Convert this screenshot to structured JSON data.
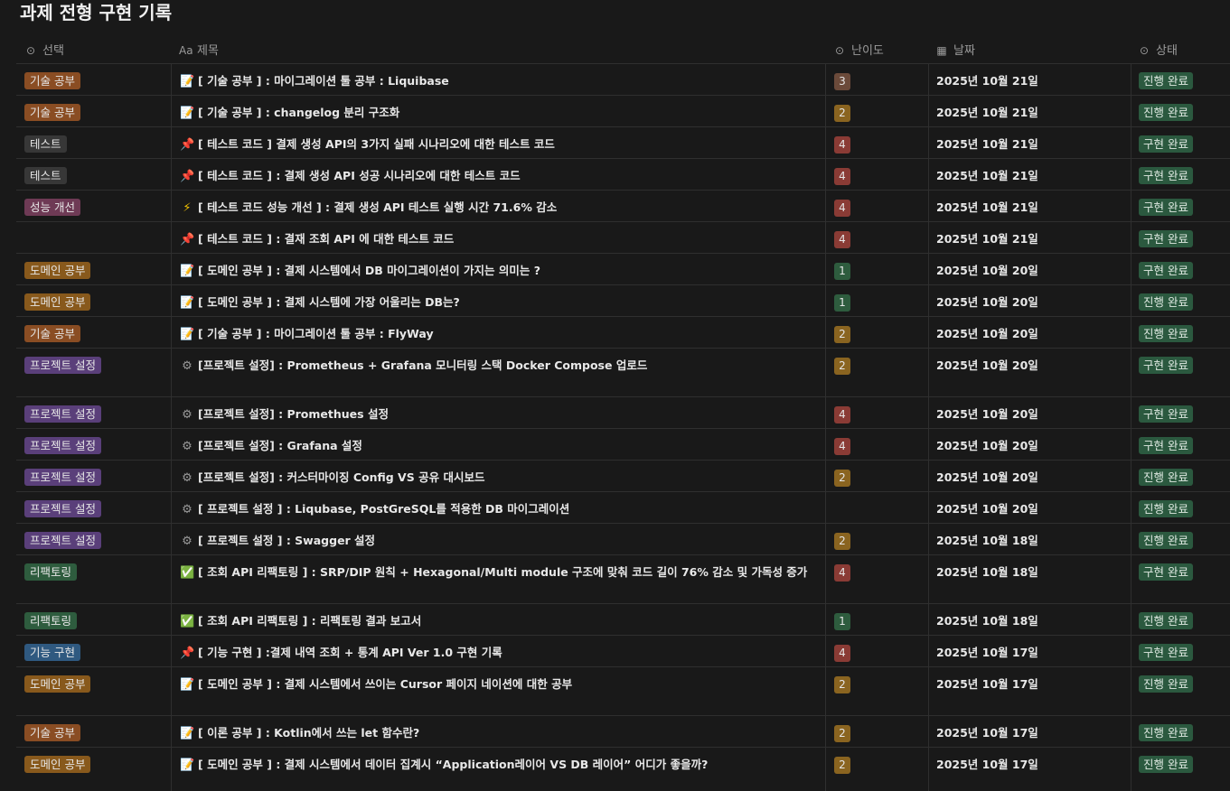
{
  "page": {
    "title": "과제 전형 구현 기록"
  },
  "columns": {
    "select": {
      "label": "선택",
      "icon": "chevron-circle-icon"
    },
    "title": {
      "label": "제목",
      "icon": "text-aa-icon"
    },
    "difficulty": {
      "label": "난이도",
      "icon": "chevron-circle-icon"
    },
    "date": {
      "label": "날짜",
      "icon": "calendar-icon"
    },
    "status": {
      "label": "상태",
      "icon": "chevron-circle-icon"
    }
  },
  "colors": {
    "tag": {
      "기술 공부": "#8a4d23",
      "테스트": "#373737",
      "성능 개선": "#6e3a55",
      "도메인 공부": "#88591c",
      "프로젝트 설정": "#5a3f7a",
      "리팩토링": "#2e5c3e",
      "기능 구현": "#2f5980"
    },
    "difficulty": {
      "1": "#2e5c3e",
      "2": "#8a6420",
      "3": "#6b4a3a",
      "4": "#8a3b35"
    },
    "status": "#2b593f"
  },
  "rows": [
    {
      "tag": "기술 공부",
      "icon": "📝",
      "title": "[ 기술 공부 ] : 마이그레이션 툴 공부 : Liquibase",
      "difficulty": "3",
      "date": "2025년 10월 21일",
      "status": "진행 완료",
      "tall": false
    },
    {
      "tag": "기술 공부",
      "icon": "📝",
      "title": "[ 기술 공부 ] : changelog 분리 구조화",
      "difficulty": "2",
      "date": "2025년 10월 21일",
      "status": "진행 완료",
      "tall": false
    },
    {
      "tag": "테스트",
      "icon": "📌",
      "title": "[ 테스트 코드 ] 결제 생성 API의 3가지 실패 시나리오에 대한 테스트 코드",
      "difficulty": "4",
      "date": "2025년 10월 21일",
      "status": "구현 완료",
      "tall": false
    },
    {
      "tag": "테스트",
      "icon": "📌",
      "title": "[ 테스트 코드 ] : 결제 생성 API 성공 시나리오에 대한 테스트 코드",
      "difficulty": "4",
      "date": "2025년 10월 21일",
      "status": "구현 완료",
      "tall": false
    },
    {
      "tag": "성능 개선",
      "icon": "⚡",
      "title": "[ 테스트 코드 성능 개선 ] :  결제 생성 API 테스트 실행 시간 71.6% 감소",
      "difficulty": "4",
      "date": "2025년 10월 21일",
      "status": "구현 완료",
      "tall": false
    },
    {
      "tag": "",
      "icon": "📌",
      "title": "[ 테스트 코드 ] : 결재 조회 API 에 대한 테스트 코드",
      "difficulty": "4",
      "date": "2025년 10월 21일",
      "status": "구현 완료",
      "tall": false
    },
    {
      "tag": "도메인 공부",
      "icon": "📝",
      "title": "[ 도메인 공부 ] : 결제 시스템에서 DB 마이그레이션이 가지는 의미는 ?",
      "difficulty": "1",
      "date": "2025년 10월 20일",
      "status": "구현 완료",
      "tall": false
    },
    {
      "tag": "도메인 공부",
      "icon": "📝",
      "title": "[ 도메인 공부 ] : 결제 시스템에 가장 어울리는 DB는?",
      "difficulty": "1",
      "date": "2025년 10월 20일",
      "status": "진행 완료",
      "tall": false
    },
    {
      "tag": "기술 공부",
      "icon": "📝",
      "title": "[ 기술 공부 ] : 마이그레이션 툴 공부 : FlyWay",
      "difficulty": "2",
      "date": "2025년 10월 20일",
      "status": "진행 완료",
      "tall": false
    },
    {
      "tag": "프로젝트 설정",
      "icon": "⚙",
      "title": "[프로젝트 설정] : Prometheus + Grafana 모니터링 스택 Docker Compose 업로드",
      "difficulty": "2",
      "date": "2025년 10월 20일",
      "status": "구현 완료",
      "tall": true
    },
    {
      "tag": "프로젝트 설정",
      "icon": "⚙",
      "title": "[프로젝트 설정] : Promethues 설정",
      "difficulty": "4",
      "date": "2025년 10월 20일",
      "status": "구현 완료",
      "tall": false
    },
    {
      "tag": "프로젝트 설정",
      "icon": "⚙",
      "title": "[프로젝트 설정] : Grafana 설정",
      "difficulty": "4",
      "date": "2025년 10월 20일",
      "status": "구현 완료",
      "tall": false
    },
    {
      "tag": "프로젝트 설정",
      "icon": "⚙",
      "title": "[프로젝트 설정] : 커스터마이징 Config VS 공유 대시보드",
      "difficulty": "2",
      "date": "2025년 10월 20일",
      "status": "진행 완료",
      "tall": false
    },
    {
      "tag": "프로젝트 설정",
      "icon": "⚙",
      "title": "[ 프로젝트 설정 ] : Liqubase, PostGreSQL를 적용한 DB 마이그레이션",
      "difficulty": "",
      "date": "2025년 10월 20일",
      "status": "진행 완료",
      "tall": false
    },
    {
      "tag": "프로젝트 설정",
      "icon": "⚙",
      "title": "[ 프로젝트 설정 ] : Swagger 설정",
      "difficulty": "2",
      "date": "2025년 10월 18일",
      "status": "진행 완료",
      "tall": false
    },
    {
      "tag": "리팩토링",
      "icon": "✅",
      "title": "[ 조회 API  리팩토링 ] : SRP/DIP 원칙 + Hexagonal/Multi module 구조에 맞춰 코드 길이 76% 감소 및 가독성 증가",
      "difficulty": "4",
      "date": "2025년 10월 18일",
      "status": "구현 완료",
      "tall": true
    },
    {
      "tag": "리팩토링",
      "icon": "✅",
      "title": "[ 조회 API 리팩토링 ] : 리팩토링 결과 보고서",
      "difficulty": "1",
      "date": "2025년 10월 18일",
      "status": "진행 완료",
      "tall": false
    },
    {
      "tag": "기능 구현",
      "icon": "📌",
      "title": "[ 기능 구현 ] :결제 내역 조회 + 통계 API Ver 1.0 구현 기록",
      "difficulty": "4",
      "date": "2025년 10월 17일",
      "status": "구현 완료",
      "tall": false
    },
    {
      "tag": "도메인 공부",
      "icon": "📝",
      "title": "[ 도메인 공부 ] : 결제 시스템에서 쓰이는 Cursor 페이지 네이션에 대한 공부",
      "difficulty": "2",
      "date": "2025년 10월 17일",
      "status": "진행 완료",
      "tall": true
    },
    {
      "tag": "기술 공부",
      "icon": "📝",
      "title": "[ 이론 공부 ] : Kotlin에서 쓰는 let 함수란?",
      "difficulty": "2",
      "date": "2025년 10월 17일",
      "status": "진행 완료",
      "tall": false
    },
    {
      "tag": "도메인 공부",
      "icon": "📝",
      "title": "[ 도메인 공부 ] : 결제 시스템에서 데이터 집계시 “Application레이어 VS DB 레이어” 어디가 좋을까?",
      "difficulty": "2",
      "date": "2025년 10월 17일",
      "status": "진행 완료",
      "tall": true
    }
  ]
}
